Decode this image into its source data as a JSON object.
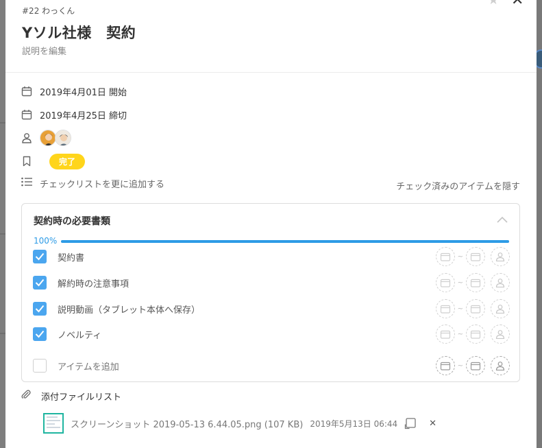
{
  "task": {
    "number_label": "#22 わっくん",
    "title": "Yソル社様　契約",
    "description_placeholder": "説明を編集"
  },
  "details": {
    "start": "2019年4月01日 開始",
    "due": "2019年4月25日 締切",
    "status": "完了",
    "status_color": "#ffd51b"
  },
  "checklist_controls": {
    "add_label": "チェックリストを更に追加する",
    "hide_checked_label": "チェック済みのアイテムを隠す"
  },
  "checklist": {
    "title": "契約時の必要書類",
    "progress_label": "100%",
    "progress": 1.0,
    "items": [
      {
        "label": "契約書",
        "checked": true
      },
      {
        "label": "解約時の注意事項",
        "checked": true
      },
      {
        "label": "説明動画（タブレット本体へ保存）",
        "checked": true
      },
      {
        "label": "ノベルティ",
        "checked": true
      }
    ],
    "add_item_label": "アイテムを追加",
    "date_separator": "~",
    "accent_color": "#4ba6ef"
  },
  "attachments": {
    "title": "添付ファイルリスト",
    "files": [
      {
        "name": "スクリーンショット 2019-05-13 6.44.05.png (107 KB)",
        "date": "2019年5月13日 06:44"
      }
    ]
  },
  "icons": {
    "star": "star-icon",
    "close": "close-icon",
    "calendar": "calendar-icon",
    "person": "person-icon",
    "bookmark": "bookmark-icon",
    "list": "list-icon",
    "chevron": "chevron-up-icon",
    "paperclip": "paperclip-icon"
  }
}
